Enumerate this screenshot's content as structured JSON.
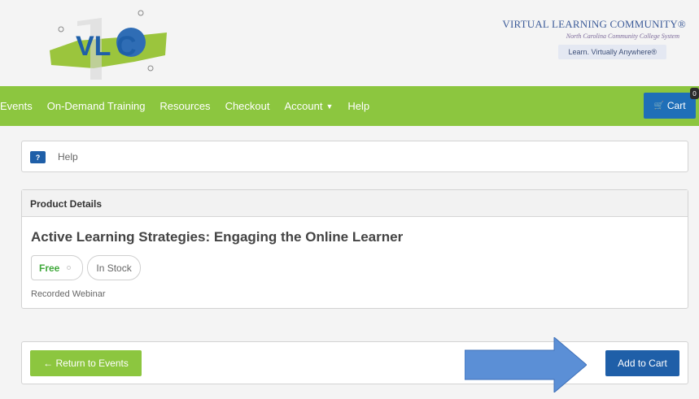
{
  "header": {
    "logo_text": "VLC",
    "brand_title": "VIRTUAL LEARNING COMMUNITY®",
    "brand_subtitle": "North Carolina Community College System",
    "tagline": "Learn. Virtually Anywhere®"
  },
  "nav": {
    "items": [
      {
        "label": "Events"
      },
      {
        "label": "On-Demand Training"
      },
      {
        "label": "Resources"
      },
      {
        "label": "Checkout"
      },
      {
        "label": "Account"
      },
      {
        "label": "Help"
      }
    ],
    "cart_label": "Cart",
    "cart_count": "0"
  },
  "help": {
    "badge": "?",
    "label": "Help"
  },
  "product": {
    "panel_title": "Product Details",
    "title": "Active Learning Strategies: Engaging the Online Learner",
    "price_tag": "Free",
    "stock_tag": "In Stock",
    "type": "Recorded Webinar"
  },
  "actions": {
    "return_label": "← Return to Events",
    "add_label": "Add to Cart"
  },
  "colors": {
    "nav_green": "#8cc63f",
    "primary_blue": "#1f5fa8",
    "annotation_arrow": "#5b8fd6"
  }
}
